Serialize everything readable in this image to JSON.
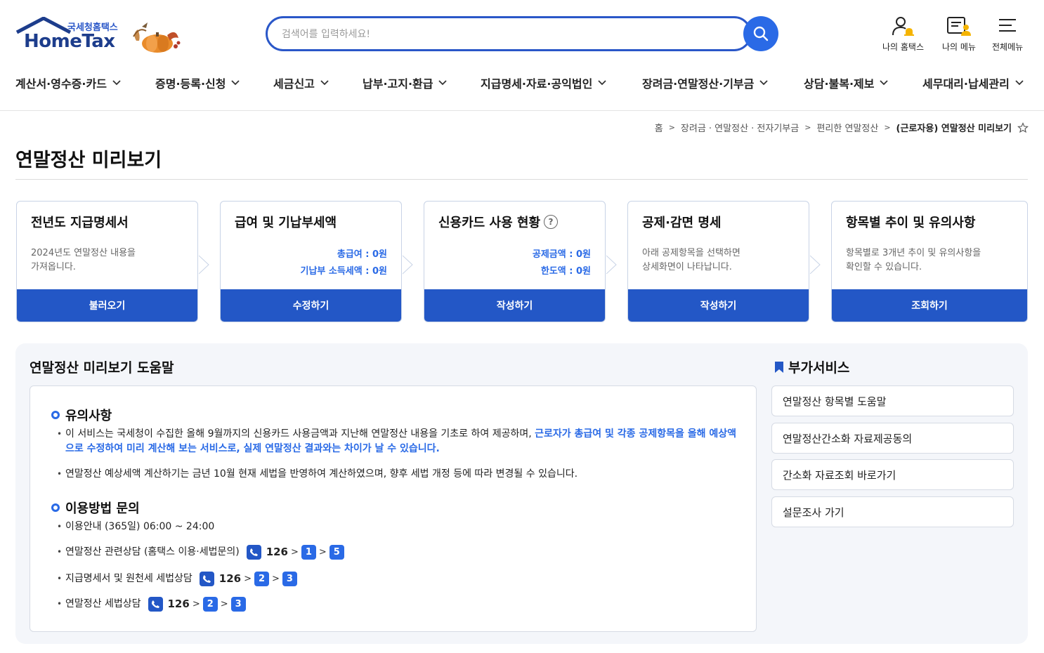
{
  "logo": {
    "sub": "국세청홈택스",
    "main": "HomeTax"
  },
  "search": {
    "placeholder": "검색어를 입력하세요!"
  },
  "util": {
    "my_hometax": "나의 홈택스",
    "my_menu": "나의 메뉴",
    "all_menu": "전체메뉴"
  },
  "gnb": [
    "계산서·영수증·카드",
    "증명·등록·신청",
    "세금신고",
    "납부·고지·환급",
    "지급명세·자료·공익법인",
    "장려금·연말정산·기부금",
    "상담·불복·제보",
    "세무대리·납세관리"
  ],
  "breadcrumb": [
    "홈",
    "장려금 · 연말정산 · 전자기부금",
    "편리한 연말정산",
    "(근로자용) 연말정산 미리보기"
  ],
  "page_title": "연말정산 미리보기",
  "cards": [
    {
      "title": "전년도 지급명세서",
      "desc1": "2024년도 연말정산 내용을",
      "desc2": "가져옵니다.",
      "button": "불러오기"
    },
    {
      "title": "급여 및 기납부세액",
      "amt1": "총급여 : 0원",
      "amt2": "기납부 소득세액 : 0원",
      "button": "수정하기"
    },
    {
      "title": "신용카드 사용 현황",
      "help": "?",
      "amt1": "공제금액 : 0원",
      "amt2": "한도액 : 0원",
      "button": "작성하기"
    },
    {
      "title": "공제·감면 명세",
      "desc1": "아래 공제항목을 선택하면",
      "desc2": "상세화면이 나타납니다.",
      "button": "작성하기"
    },
    {
      "title": "항목별 추이 및 유의사항",
      "desc1": "항목별로 3개년 추이 및 유의사항을",
      "desc2": "확인할 수 있습니다.",
      "button": "조회하기"
    }
  ],
  "help": {
    "title": "연말정산 미리보기 도움말",
    "notice_title": "유의사항",
    "notice1_plain": "이 서비스는 국세청이 수집한 올해 9월까지의 신용카드 사용금액과 지난해 연말정산 내용을 기초로 하여 제공하며, ",
    "notice1_hl": "근로자가 총급여 및 각종 공제항목을 올해 예상액으로 수정하여 미리 계산해 보는 서비스로, 실제 연말정산 결과와는 차이가 날 수 있습니다.",
    "notice2": "연말정산 예상세액 계산하기는 금년 10월 현재 세법을 반영하여 계산하였으며, 향후 세법 개정 등에 따라 변경될 수 있습니다.",
    "usage_title": "이용방법 문의",
    "hours": "이용안내 (365일) 06:00 ~ 24:00",
    "lines": [
      {
        "label": "연말정산 관련상담 (홈택스 이용·세법문의)",
        "num": "126",
        "k1": "1",
        "k2": "5"
      },
      {
        "label": "지급명세서 및 원천세 세법상담",
        "num": "126",
        "k1": "2",
        "k2": "3"
      },
      {
        "label": "연말정산 세법상담",
        "num": "126",
        "k1": "2",
        "k2": "3"
      }
    ]
  },
  "side": {
    "title": "부가서비스",
    "items": [
      "연말정산 항목별 도움말",
      "연말정산간소화 자료제공동의",
      "간소화 자료조회 바로가기",
      "설문조사 가기"
    ]
  },
  "colors": {
    "primary": "#2357c6",
    "accent": "#2a6ae6",
    "brand": "#1d3d8c"
  }
}
